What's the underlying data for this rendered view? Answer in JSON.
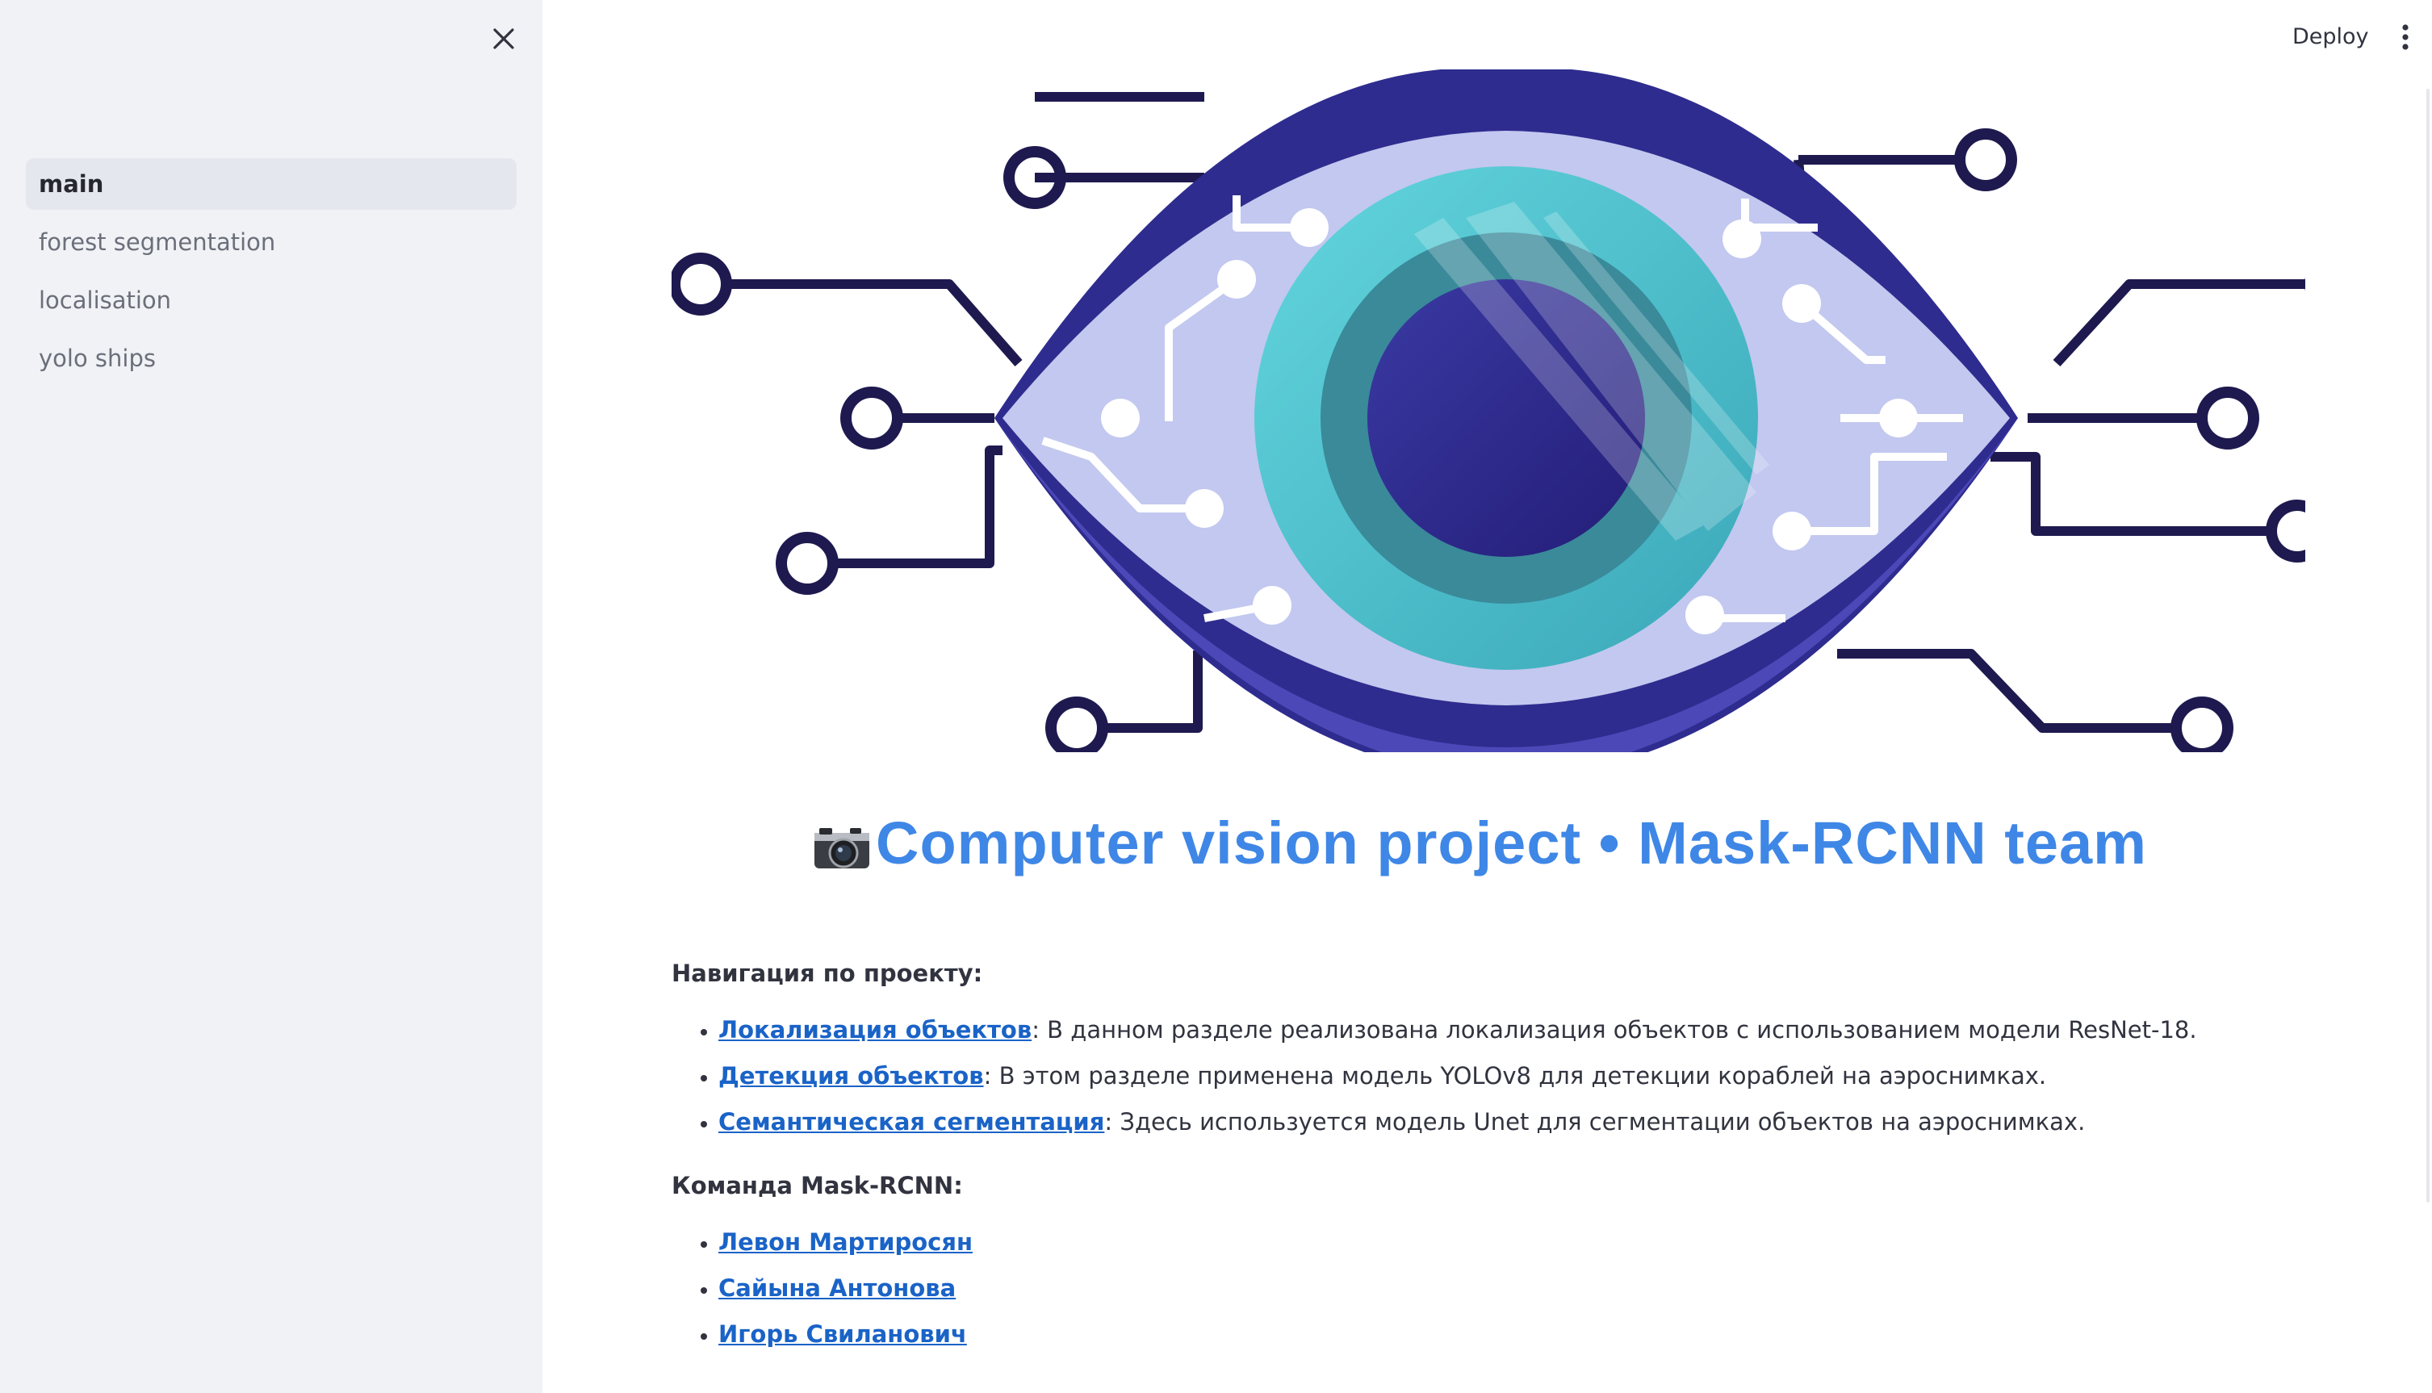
{
  "sidebar": {
    "close_icon": "close-icon",
    "items": [
      {
        "label": "main",
        "active": true
      },
      {
        "label": "forest segmentation",
        "active": false
      },
      {
        "label": "localisation",
        "active": false
      },
      {
        "label": "yolo ships",
        "active": false
      }
    ]
  },
  "header": {
    "deploy_label": "Deploy",
    "menu_icon": "more-vert-icon"
  },
  "hero": {
    "icon": "cyber-eye-illustration"
  },
  "title": {
    "emoji_icon": "camera-icon",
    "text": "Computer vision project • Mask-RCNN team",
    "color": "#3f87e6"
  },
  "navigation": {
    "heading": "Навигация по проекту:",
    "items": [
      {
        "link": "Локализация объектов",
        "text": ": В данном разделе реализована локализация объектов с использованием модели ResNet-18."
      },
      {
        "link": "Детекция объектов",
        "text": ": В этом разделе применена модель YOLOv8 для детекции кораблей на аэроснимках."
      },
      {
        "link": "Семантическая сегментация",
        "text": ": Здесь используется модель Unet для сегментации объектов на аэроснимках."
      }
    ]
  },
  "team": {
    "heading": "Команда Mask-RCNN:",
    "members": [
      "Левон Мартиросян",
      "Сайына Антонова",
      "Игорь Свиланович"
    ]
  },
  "colors": {
    "sidebar_bg": "#f0f2f6",
    "link": "#1a63c7",
    "eye_dark": "#2e2b8c",
    "eye_light": "#c2c8ef",
    "iris_teal": "#4fc7d0"
  }
}
